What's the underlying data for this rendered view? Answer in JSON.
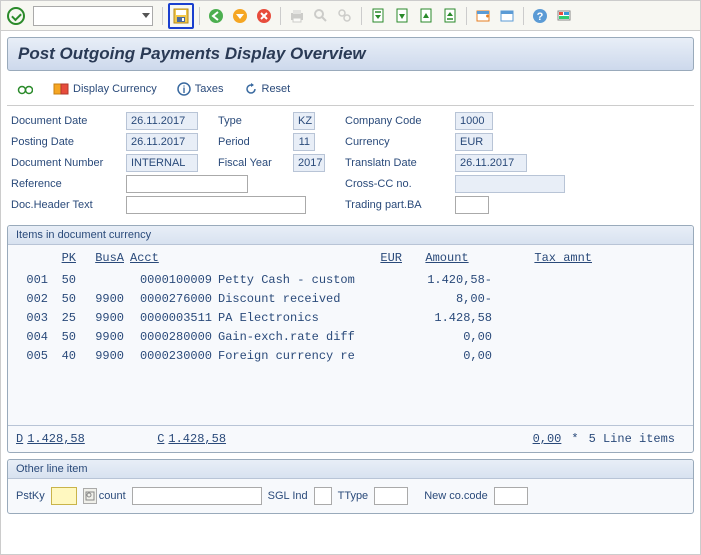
{
  "title": "Post Outgoing Payments Display Overview",
  "app_toolbar": {
    "display_currency": "Display Currency",
    "taxes": "Taxes",
    "reset": "Reset"
  },
  "form": {
    "doc_date_lbl": "Document Date",
    "doc_date": "26.11.2017",
    "type_lbl": "Type",
    "type": "KZ",
    "company_lbl": "Company Code",
    "company": "1000",
    "posting_lbl": "Posting Date",
    "posting": "26.11.2017",
    "period_lbl": "Period",
    "period": "11",
    "currency_lbl": "Currency",
    "currency": "EUR",
    "docnum_lbl": "Document Number",
    "docnum": "INTERNAL",
    "fy_lbl": "Fiscal Year",
    "fy": "2017",
    "trans_lbl": "Translatn Date",
    "trans": "26.11.2017",
    "ref_lbl": "Reference",
    "ref": "",
    "cross_lbl": "Cross-CC no.",
    "cross": "",
    "head_lbl": "Doc.Header Text",
    "head": "",
    "trade_lbl": "Trading part.BA",
    "trade": ""
  },
  "items_box": {
    "title": "Items in document currency",
    "hdr_pk": "PK",
    "hdr_busa": "BusA",
    "hdr_acct": "Acct",
    "hdr_cur": "EUR",
    "hdr_amt": "Amount",
    "hdr_tax": "Tax amnt",
    "rows": [
      {
        "idx": "001",
        "pk": "50",
        "busa": "",
        "acct": "0000100009",
        "desc": "Petty Cash - custom",
        "amt": "1.420,58-",
        "tax": ""
      },
      {
        "idx": "002",
        "pk": "50",
        "busa": "9900",
        "acct": "0000276000",
        "desc": "Discount received",
        "amt": "8,00-",
        "tax": ""
      },
      {
        "idx": "003",
        "pk": "25",
        "busa": "9900",
        "acct": "0000003511",
        "desc": "PA Electronics",
        "amt": "1.428,58",
        "tax": ""
      },
      {
        "idx": "004",
        "pk": "50",
        "busa": "9900",
        "acct": "0000280000",
        "desc": "Gain-exch.rate diff",
        "amt": "0,00",
        "tax": ""
      },
      {
        "idx": "005",
        "pk": "40",
        "busa": "9900",
        "acct": "0000230000",
        "desc": "Foreign currency re",
        "amt": "0,00",
        "tax": ""
      }
    ],
    "foot_d": "D",
    "foot_d_amt": "1.428,58",
    "foot_c": "C",
    "foot_c_amt": "1.428,58",
    "foot_bal": "0,00",
    "foot_star": "*",
    "foot_count": "5 Line items"
  },
  "other_box": {
    "title": "Other line item",
    "pstky_lbl": "PstKy",
    "pstky": "",
    "account_lbl": "Account",
    "account": "",
    "sgl_lbl": "SGL Ind",
    "sgl": "",
    "ttype_lbl": "TType",
    "ttype": "",
    "newco_lbl": "New co.code",
    "newco": ""
  }
}
